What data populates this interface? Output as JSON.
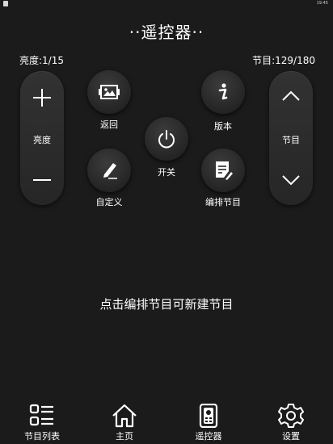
{
  "status": {
    "time": "19:45"
  },
  "header": {
    "title": "··遥控器··"
  },
  "info": {
    "brightness": "亮度:1/15",
    "channel": "节目:129/180"
  },
  "brightness_pill": {
    "label": "亮度"
  },
  "channel_pill": {
    "label": "节目"
  },
  "buttons": {
    "back": "返回",
    "version": "版本",
    "power": "开关",
    "custom": "自定义",
    "edit": "编排节目"
  },
  "hint": "点击编排节目可新建节目",
  "tabs": [
    {
      "label": "节目列表",
      "icon": "list-icon"
    },
    {
      "label": "主页",
      "icon": "home-icon"
    },
    {
      "label": "遥控器",
      "icon": "remote-icon",
      "active": true
    },
    {
      "label": "设置",
      "icon": "gear-icon"
    }
  ]
}
